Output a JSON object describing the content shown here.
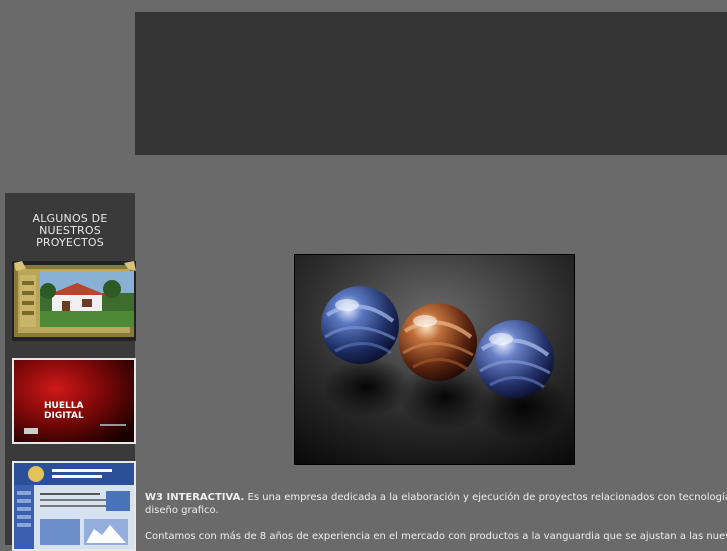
{
  "sidebar": {
    "title_lines": [
      "ALGUNOS DE",
      "NUESTROS",
      "PROYECTOS"
    ],
    "projects": [
      {
        "name": "rustic-house-project"
      },
      {
        "name": "huella-digital-project",
        "logo_line1": "HUELLA",
        "logo_line2": "DIGITAL"
      },
      {
        "name": "blue-website-project"
      }
    ]
  },
  "content": {
    "brand": "W3 INTERACTIVA.",
    "paragraph1_rest": " Es una empresa dedicada a la elaboración y ejecución de proyectos relacionados con tecnología y",
    "paragraph1_line2": "diseño grafico.",
    "paragraph2": "Contamos con más de 8 años de experiencia en el mercado con productos a la  vanguardia que se ajustan a las nuevas"
  },
  "colors": {
    "page_bg": "#6a6a6a",
    "banner_bg": "#353535",
    "sidebar_bg": "#3a3a3a",
    "text": "#eeeeee"
  }
}
